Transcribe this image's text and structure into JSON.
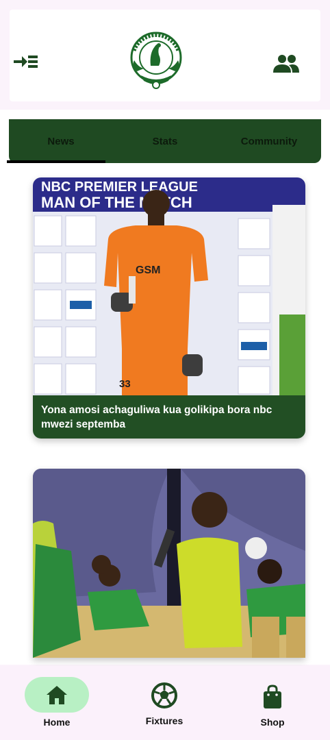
{
  "header": {
    "logo_text_top": "PAMBA JIJI FOOTBALL CLUB",
    "logo_text_bottom": "MWANZA"
  },
  "tabs": [
    {
      "label": "News",
      "active": true
    },
    {
      "label": "Stats",
      "active": false
    },
    {
      "label": "Community",
      "active": false
    }
  ],
  "news": [
    {
      "caption": "Yona amosi achaguliwa kua golikipa bora nbc mwezi septemba",
      "banner_line1": "NBC PREMIER LEAGUE",
      "banner_line2": "MAN OF THE MATCH",
      "shirt_text": "GSM",
      "shirt_number": "33"
    },
    {
      "caption": ""
    }
  ],
  "bottom_nav": [
    {
      "label": "Home",
      "icon": "home-icon",
      "active": true
    },
    {
      "label": "Fixtures",
      "icon": "soccer-ball-icon",
      "active": false
    },
    {
      "label": "Shop",
      "icon": "shopping-bag-icon",
      "active": false
    }
  ],
  "colors": {
    "primary_green": "#1f4a22",
    "active_pill": "#b8f0c4",
    "background": "#fbf3fb"
  }
}
